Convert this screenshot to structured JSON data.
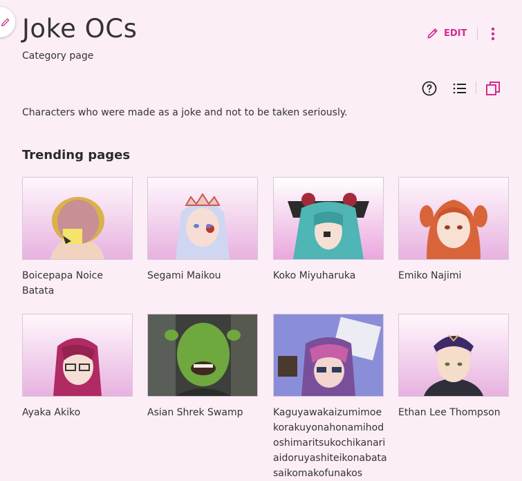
{
  "page": {
    "title": "Joke OCs",
    "subtitle": "Category page",
    "description": "Characters who were made as a joke and not to be taken seriously."
  },
  "toolbar": {
    "edit_label": "EDIT"
  },
  "icons": {
    "fab": "pencil-icon",
    "edit": "pencil-icon",
    "more": "kebab-menu-icon",
    "help": "help-circle-icon",
    "list": "list-view-icon",
    "gallery": "gallery-view-icon"
  },
  "colors": {
    "accent": "#d22c8b",
    "background": "#fbeef7"
  },
  "trending": {
    "heading": "Trending pages",
    "items": [
      {
        "label": "Boicepapa Noice Batata"
      },
      {
        "label": "Segami Maikou"
      },
      {
        "label": "Koko Miyuharuka"
      },
      {
        "label": "Emiko Najimi"
      },
      {
        "label": "Ayaka Akiko"
      },
      {
        "label": "Asian Shrek Swamp"
      },
      {
        "label": "Kaguyawakaizumimoekorakuyonahonamihodoshimaritsukochikanariaidoruyashiteikonabatasaikomakofunakos"
      },
      {
        "label": "Ethan Lee Thompson"
      }
    ]
  }
}
